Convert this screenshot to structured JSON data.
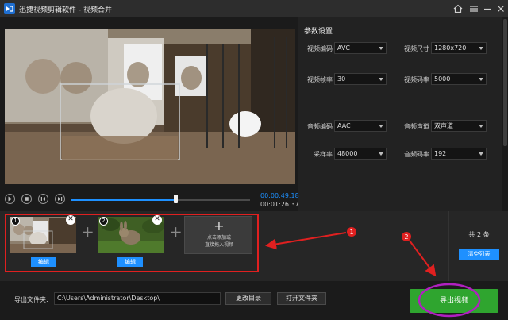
{
  "window": {
    "title": "迅捷视频剪辑软件 - 视频合并",
    "icons": [
      "app-logo-icon",
      "home-icon",
      "settings-icon",
      "minimize-icon",
      "close-icon"
    ]
  },
  "params": {
    "title": "参数设置",
    "video": {
      "codec_label": "视频编码",
      "codec_value": "AVC",
      "size_label": "视频尺寸",
      "size_value": "1280x720",
      "fps_label": "视频帧率",
      "fps_value": "30",
      "bitrate_label": "视频码率",
      "bitrate_value": "5000"
    },
    "audio": {
      "codec_label": "音频编码",
      "codec_value": "AAC",
      "channel_label": "音频声道",
      "channel_value": "双声道",
      "samplerate_label": "采样率",
      "samplerate_value": "48000",
      "bitrate_label": "音频码率",
      "bitrate_value": "192"
    }
  },
  "player": {
    "current_time": "00:00:49.18",
    "total_time": "00:01:26.37",
    "progress": 0.58
  },
  "clips": {
    "items": [
      {
        "index": "1",
        "edit_label": "编辑",
        "close": "✕"
      },
      {
        "index": "2",
        "edit_label": "编辑",
        "close": "✕"
      }
    ],
    "add_line1": "点击添加或",
    "add_line2": "直接拖入视频",
    "count": "共 2 条",
    "clear_label": "清空列表"
  },
  "annotations": {
    "marker1": "1",
    "marker2": "2"
  },
  "output": {
    "label": "导出文件夹:",
    "path": "C:\\Users\\Administrator\\Desktop\\",
    "change_dir_label": "更改目录",
    "open_folder_label": "打开文件夹",
    "export_label": "导出视频"
  },
  "colors": {
    "accent": "#1e90ff",
    "export": "#2fa52f",
    "annotation": "#e02020",
    "highlight": "#b020c0"
  }
}
